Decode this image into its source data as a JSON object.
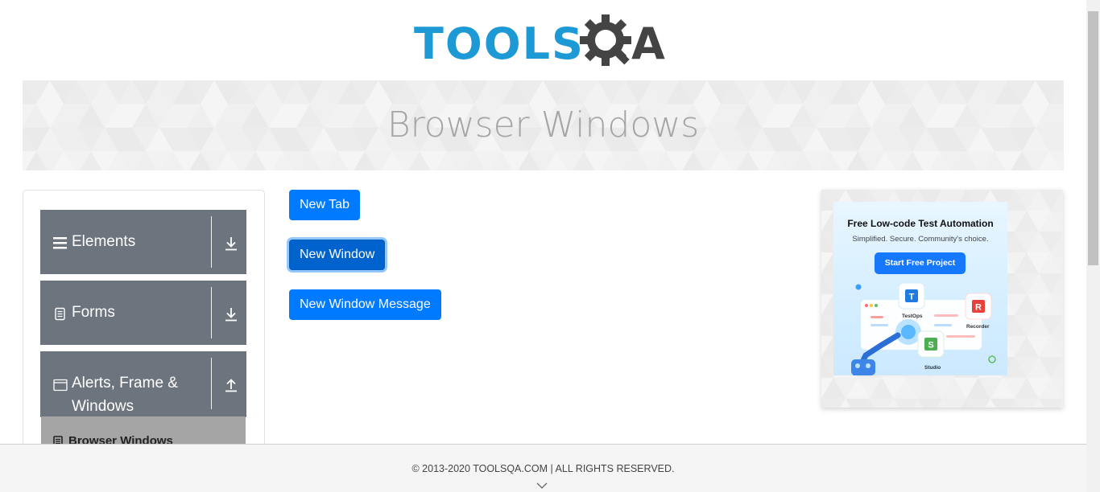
{
  "header": {
    "logo_text": "TOOLS",
    "logo_q_icon": "gear-magnifier-icon",
    "logo_a": "A"
  },
  "banner": {
    "title": "Browser Windows"
  },
  "sidebar": {
    "groups": [
      {
        "label": "Elements",
        "icon": "hamburger-icon",
        "arrow": "download-arrow-icon"
      },
      {
        "label": "Forms",
        "icon": "document-icon",
        "arrow": "download-arrow-icon"
      },
      {
        "label": "Alerts, Frame &",
        "label_line2": "Windows",
        "icon": "window-icon",
        "arrow": "upload-arrow-icon"
      }
    ],
    "sub_items": [
      {
        "label": "Browser Windows",
        "icon": "document-icon"
      }
    ]
  },
  "main": {
    "buttons": [
      {
        "label": "New Tab"
      },
      {
        "label": "New Window",
        "focused": true
      },
      {
        "label": "New Window Message"
      }
    ]
  },
  "ad": {
    "title": "Free Low-code Test Automation",
    "subtitle": "Simplified. Secure. Community's choice.",
    "cta": "Start Free Project",
    "labels": [
      "TestOps",
      "Recorder",
      "Studio"
    ]
  },
  "footer": {
    "copyright": "© 2013-2020 TOOLSQA.COM | ALL RIGHTS RESERVED."
  },
  "colors": {
    "primary": "#007bff",
    "sidebar_header": "#6c757d",
    "sidebar_active": "#a5a5a5",
    "logo_blue": "#1d9ad6",
    "logo_dark": "#444444"
  }
}
